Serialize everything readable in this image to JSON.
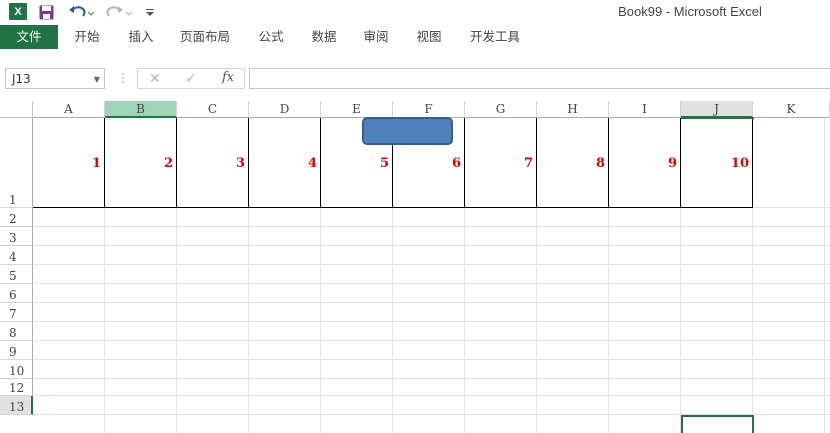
{
  "title_bar": {
    "excel_logo": "X",
    "window_title": "Book99 - Microsoft Excel",
    "icons": [
      "excel-icon",
      "save-icon",
      "undo-icon",
      "redo-icon",
      "customize-icon"
    ]
  },
  "ribbon": {
    "tabs": [
      {
        "id": "file",
        "label": "文件"
      },
      {
        "id": "home",
        "label": "开始"
      },
      {
        "id": "insert",
        "label": "插入"
      },
      {
        "id": "page_layout",
        "label": "页面布局"
      },
      {
        "id": "formulas",
        "label": "公式"
      },
      {
        "id": "data",
        "label": "数据"
      },
      {
        "id": "review",
        "label": "审阅"
      },
      {
        "id": "view",
        "label": "视图"
      },
      {
        "id": "developer",
        "label": "开发工具"
      }
    ],
    "accent_color": "#217346"
  },
  "formula_bar": {
    "name_box": "J13",
    "formula_value": "",
    "fx_label": "fx"
  },
  "sheet": {
    "columns": [
      "A",
      "B",
      "C",
      "D",
      "E",
      "F",
      "G",
      "H",
      "I",
      "J",
      "K"
    ],
    "rows": [
      "1",
      "2",
      "3",
      "4",
      "5",
      "6",
      "7",
      "8",
      "9",
      "10",
      "12",
      "13"
    ],
    "row1_values": [
      "1",
      "2",
      "3",
      "4",
      "5",
      "6",
      "7",
      "8",
      "9",
      "10"
    ],
    "value_color": "#e00000",
    "shape_color": "#4f81bd",
    "active_cell": "J13"
  }
}
